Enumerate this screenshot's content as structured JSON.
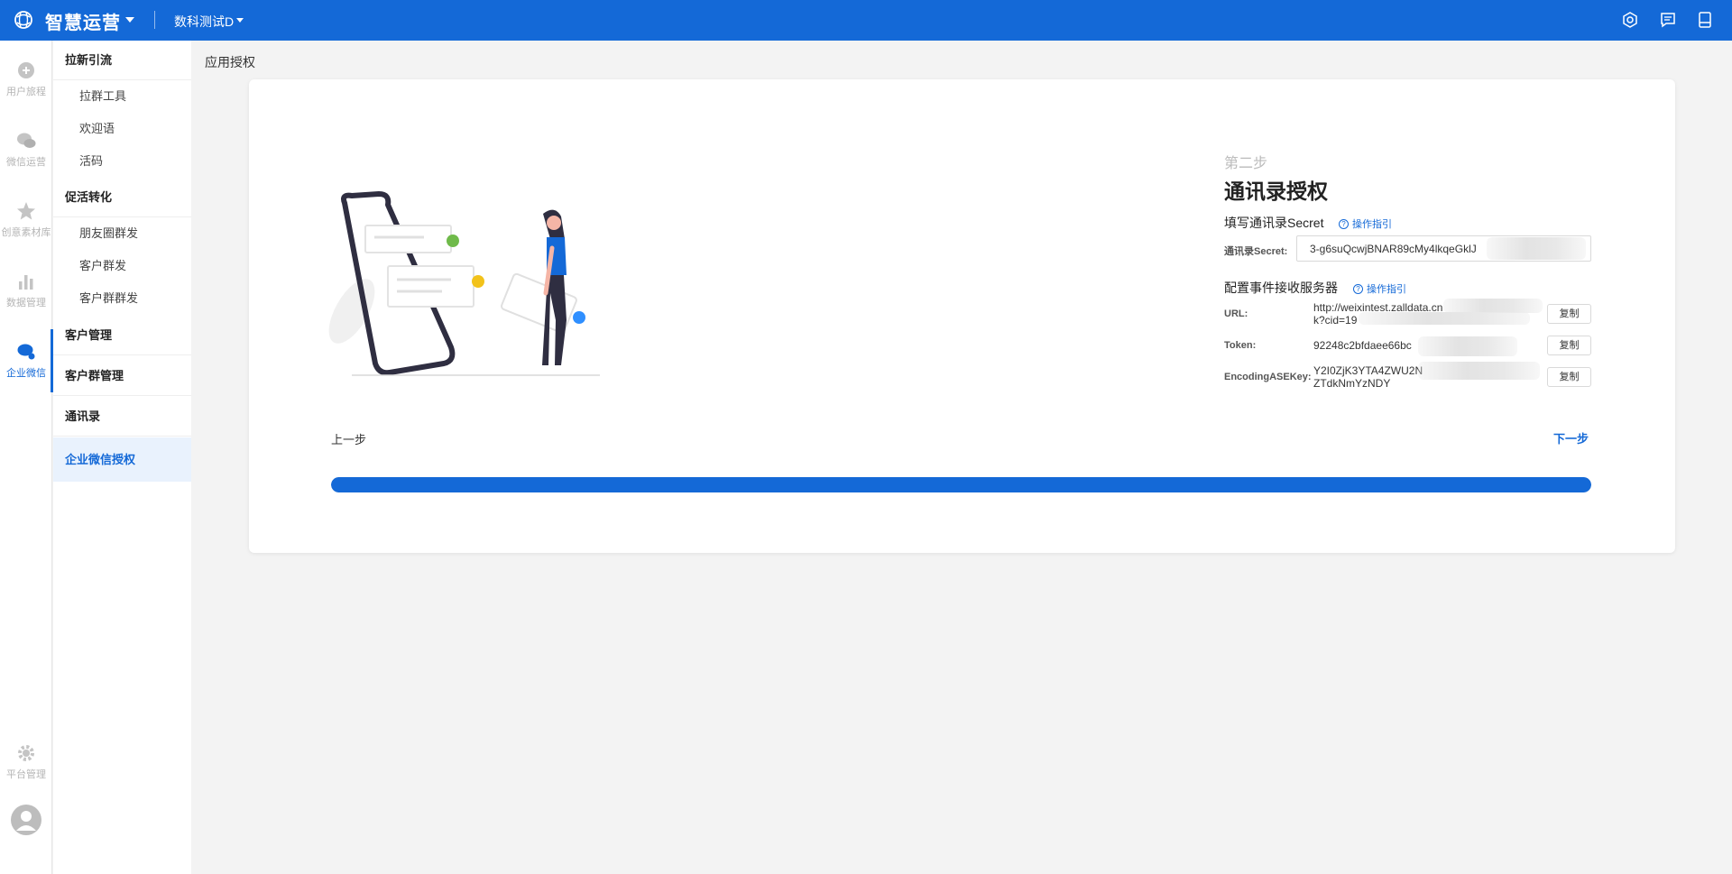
{
  "topbar": {
    "app_title": "智慧运营",
    "project": "数科测试D",
    "bg_color": "#1469d7"
  },
  "rail": [
    {
      "label": "用户旅程",
      "icon": "journey-icon"
    },
    {
      "label": "微信运营",
      "icon": "wechat-icon"
    },
    {
      "label": "创意素材库",
      "icon": "star-icon"
    },
    {
      "label": "数据管理",
      "icon": "bar-chart-icon"
    },
    {
      "label": "企业微信",
      "icon": "work-wechat-icon",
      "active": true
    },
    {
      "label": "平台管理",
      "icon": "gear-icon"
    }
  ],
  "submenu": {
    "group1": "拉新引流",
    "group1_items": [
      "拉群工具",
      "欢迎语",
      "活码"
    ],
    "group2": "促活转化",
    "group2_items": [
      "朋友圈群发",
      "客户群发",
      "客户群群发"
    ],
    "group3": "客户管理",
    "group4": "客户群管理",
    "group5": "通讯录",
    "group6": "企业微信授权"
  },
  "breadcrumb": "应用授权",
  "step": {
    "number": "第二步",
    "title": "通讯录授权",
    "secret_section": "填写通讯录Secret",
    "guide_label": "操作指引",
    "secret_label": "通讯录Secret:",
    "secret_value": "3-g6suQcwjBNAR89cMy4lkqeGklJ",
    "server_section": "配置事件接收服务器",
    "url_label": "URL:",
    "url_value_line1": "http://weixintest.zalldata.cn",
    "url_value_line2": "k?cid=19",
    "token_label": "Token:",
    "token_value": "92248c2bfdaee66bc",
    "aes_label": "EncodingASEKey:",
    "aes_value_line1": "Y2I0ZjK3YTA4ZWU2N",
    "aes_value_line2": "ZTdkNmYzNDY",
    "copy_label": "复制"
  },
  "nav": {
    "prev": "上一步",
    "next": "下一步"
  },
  "progress": {
    "fraction": 1.0,
    "color": "#1469d7"
  }
}
